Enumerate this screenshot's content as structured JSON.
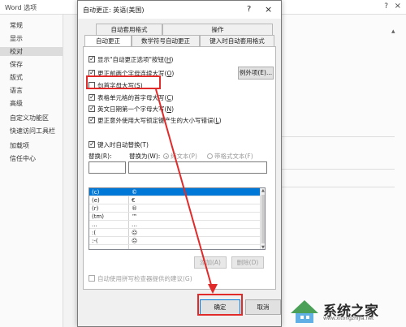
{
  "background": {
    "window_title": "Word 选项",
    "help": "?",
    "close": "×",
    "sidebar": [
      "常规",
      "显示",
      "校对",
      "保存",
      "版式",
      "语言",
      "高级",
      "自定义功能区",
      "快速访问工具栏",
      "加载项",
      "信任中心"
    ],
    "active_item": "校对"
  },
  "dialog": {
    "title": "自动更正: 英语(美国)",
    "help": "?",
    "close": "×",
    "tabs_row1": [
      "自动套用格式",
      "操作"
    ],
    "tabs_row2": [
      "自动更正",
      "数学符号自动更正",
      "键入时自动套用格式"
    ],
    "active_tab": "自动更正",
    "options": [
      {
        "label": "显示\"自动更正选项\"按钮(",
        "key": "H",
        "checked": true
      },
      {
        "label": "更正前两个字母连续大写(",
        "key": "O",
        "checked": true
      },
      {
        "label": "句首字母大写(",
        "key": "S",
        "checked": false
      },
      {
        "label": "表格单元格的首字母大写(",
        "key": "C",
        "checked": true
      },
      {
        "label": "英文日期第一个字母大写(",
        "key": "N",
        "checked": true
      },
      {
        "label": "更正意外使用大写锁定键产生的大小写错误(",
        "key": "L",
        "checked": true
      }
    ],
    "exceptions_button": "例外项(E)...",
    "replace_section": {
      "checkbox_label": "键入时自动替换(T)",
      "checked": true,
      "replace_label": "替换(R):",
      "with_label": "替换为(W):",
      "radio_plain": "纯文本(P)",
      "radio_formatted": "带格式文本(F)",
      "replace_value": "",
      "with_value": ""
    },
    "list": [
      {
        "key": "(c)",
        "value": "©"
      },
      {
        "key": "(e)",
        "value": "€"
      },
      {
        "key": "(r)",
        "value": "®"
      },
      {
        "key": "(tm)",
        "value": "™"
      },
      {
        "key": "...",
        "value": "…"
      },
      {
        "key": ":(",
        "value": "☹"
      },
      {
        "key": ":-(",
        "value": "☹"
      }
    ],
    "add_button": "添加(A)",
    "delete_button": "删除(D)",
    "spellcheck_label": "自动使用拼写检查器提供的建议(G)",
    "ok_button": "确定",
    "cancel_button": "取消"
  },
  "watermark": {
    "brand": "系统之家",
    "url": "www.xitongzhijia.net"
  },
  "colors": {
    "highlight": "#e12b2b",
    "selection": "#0078d7"
  }
}
